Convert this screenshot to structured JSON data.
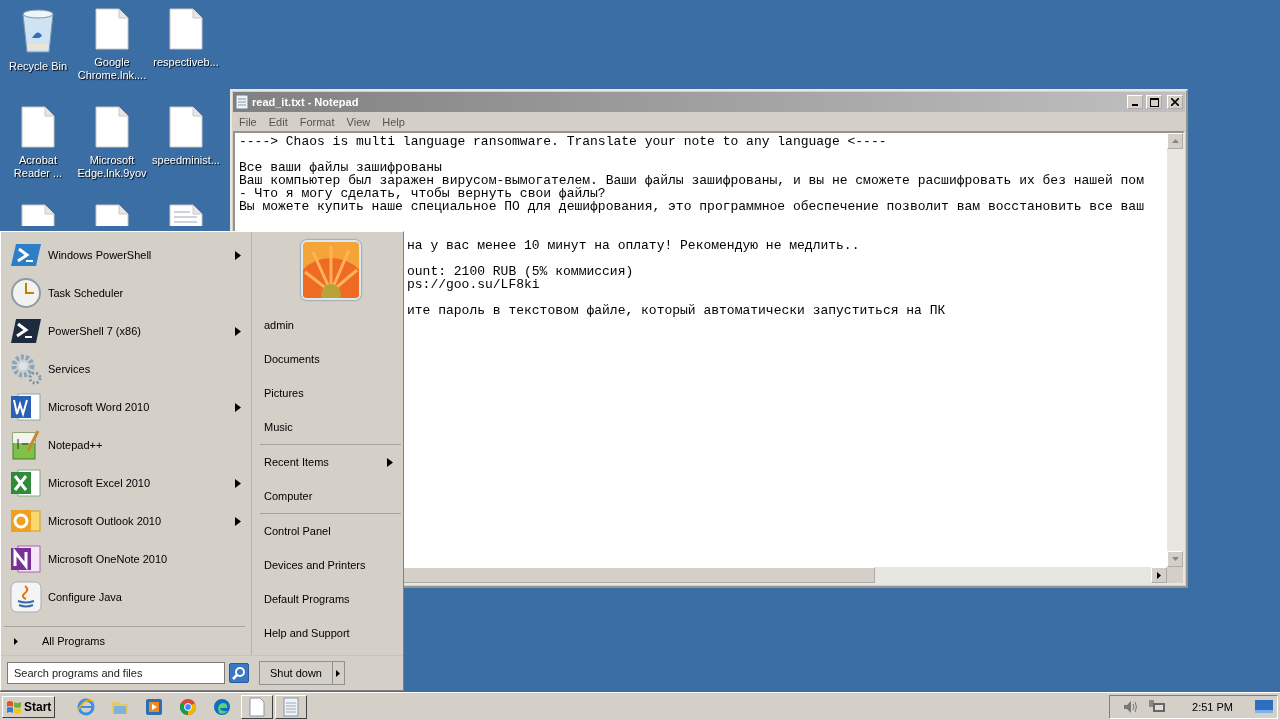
{
  "desktop_icons": [
    {
      "kind": "recycle",
      "label": "Recycle Bin"
    },
    {
      "kind": "file",
      "label": "Google Chrome.lnk...."
    },
    {
      "kind": "file",
      "label": "respectiveb..."
    },
    {
      "kind": "file",
      "label": "Acrobat Reader ..."
    },
    {
      "kind": "file",
      "label": "Microsoft Edge.lnk.9yov"
    },
    {
      "kind": "file",
      "label": "speedminist..."
    },
    {
      "kind": "file"
    },
    {
      "kind": "file"
    },
    {
      "kind": "text"
    }
  ],
  "notepad": {
    "title": "read_it.txt - Notepad",
    "menu": [
      "File",
      "Edit",
      "Format",
      "View",
      "Help"
    ],
    "lines": [
      {
        "kind": "full",
        "text": "----> Chaos is multi language ransomware. Translate your note to any language <----"
      },
      {
        "kind": "blank"
      },
      {
        "kind": "full",
        "text": "Все ваши файлы зашифрованы"
      },
      {
        "kind": "full",
        "text": "Ваш компьютер был заражен вирусом-вымогателем. Ваши файлы зашифрованы, и вы не сможете расшифровать их без нашей пом"
      },
      {
        "kind": "full",
        "text": "- Что я могу сделать, чтобы вернуть свои файлы?"
      },
      {
        "kind": "full",
        "text": "Вы можете купить наше специальное ПО для дешифрования, это программное обеспечение позволит вам восстановить все ваш"
      },
      {
        "kind": "blank"
      },
      {
        "kind": "blank"
      },
      {
        "kind": "covered",
        "text": "на у вас менее 10 минут на оплату! Рекомендую не медлить.."
      },
      {
        "kind": "blank"
      },
      {
        "kind": "covered",
        "text": "ount: 2100 RUB (5% коммиссия)"
      },
      {
        "kind": "covered",
        "text": "ps://goo.su/LF8ki"
      },
      {
        "kind": "blank"
      },
      {
        "kind": "covered",
        "text": "ите пароль в текстовом файле, который автоматически запуститься на ПК"
      }
    ]
  },
  "start_menu": {
    "programs": [
      {
        "kind": "powershell",
        "label": "Windows PowerShell",
        "submenu": true
      },
      {
        "kind": "clock",
        "label": "Task Scheduler",
        "submenu": false
      },
      {
        "kind": "terminal",
        "label": "PowerShell 7 (x86)",
        "submenu": true
      },
      {
        "kind": "gears",
        "label": "Services",
        "submenu": false
      },
      {
        "kind": "word",
        "label": "Microsoft Word 2010",
        "submenu": true
      },
      {
        "kind": "notepadpp",
        "label": "Notepad++",
        "submenu": false
      },
      {
        "kind": "excel",
        "label": "Microsoft Excel 2010",
        "submenu": true
      },
      {
        "kind": "outlook",
        "label": "Microsoft Outlook 2010",
        "submenu": true
      },
      {
        "kind": "onenote",
        "label": "Microsoft OneNote 2010",
        "submenu": false
      },
      {
        "kind": "java",
        "label": "Configure Java",
        "submenu": false
      }
    ],
    "all_programs": "All Programs",
    "places": [
      {
        "label": "admin",
        "submenu": false,
        "separator_before": false
      },
      {
        "label": "Documents",
        "submenu": false,
        "separator_before": false
      },
      {
        "label": "Pictures",
        "submenu": false,
        "separator_before": false
      },
      {
        "label": "Music",
        "submenu": false,
        "separator_before": false
      },
      {
        "label": "Recent Items",
        "submenu": true,
        "separator_before": true
      },
      {
        "label": "Computer",
        "submenu": false,
        "separator_before": false
      },
      {
        "label": "Control Panel",
        "submenu": false,
        "separator_before": true
      },
      {
        "label": "Devices and Printers",
        "submenu": false,
        "separator_before": false
      },
      {
        "label": "Default Programs",
        "submenu": false,
        "separator_before": false
      },
      {
        "label": "Help and Support",
        "submenu": false,
        "separator_before": false
      }
    ],
    "search": {
      "placeholder": "Search programs and files"
    },
    "shutdown": "Shut down"
  },
  "taskbar": {
    "start": "Start",
    "items": [
      {
        "kind": "ie"
      },
      {
        "kind": "folder"
      },
      {
        "kind": "media"
      },
      {
        "kind": "chrome"
      },
      {
        "kind": "edge"
      },
      {
        "kind": "doc-window"
      },
      {
        "kind": "notepad-window"
      }
    ],
    "tray": [
      {
        "kind": "volume"
      },
      {
        "kind": "network"
      }
    ],
    "clock": "2:51 PM"
  }
}
